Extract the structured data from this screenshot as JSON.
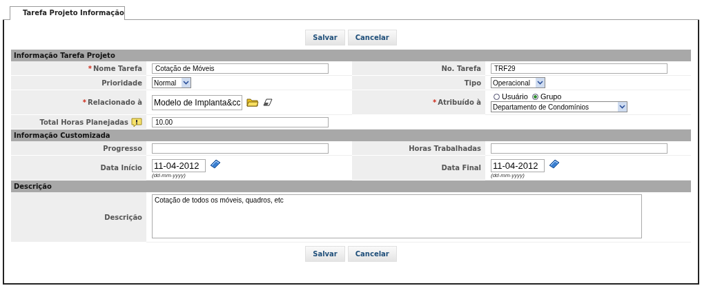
{
  "tab": {
    "label": "Tarefa Projeto Informação",
    "selected": true
  },
  "buttons_top": [
    "Salvar",
    "Cancelar"
  ],
  "sections": [
    {
      "title": "Informação Tarefa Projeto",
      "rows": [
        [
          {
            "label": "Nome Tarefa",
            "mark": "*",
            "kind": "text",
            "value": "Cotação de Móveis"
          },
          {
            "label": "No. Tarefa",
            "kind": "text",
            "value": "TRF29"
          }
        ],
        [
          {
            "label": "Prioridade",
            "kind": "select",
            "value": "Normal"
          },
          {
            "label": "Tipo",
            "kind": "select",
            "value": "Operacional"
          }
        ],
        [
          {
            "label": "Relacionado à",
            "mark": "*",
            "kind": "lookup",
            "value": "Modelo de Implanta&cc"
          },
          {
            "label": "Atribuído à",
            "mark": "*",
            "kind": "assign",
            "options": [
              {
                "label": "Usuário",
                "selected": false
              },
              {
                "label": "Grupo",
                "selected": true
              }
            ],
            "value": "Departamento de Condomínios"
          }
        ],
        [
          {
            "label": "Total Horas Planejadas",
            "help": true,
            "kind": "text",
            "value": "10.00"
          }
        ]
      ]
    },
    {
      "title": "Informação Customizada",
      "rows": [
        [
          {
            "label": "Progresso",
            "kind": "text"
          },
          {
            "label": "Horas Trabalhadas",
            "kind": "text"
          }
        ],
        [
          {
            "label": "Data Início",
            "kind": "date",
            "value": "11-04-2012",
            "hint": "(dd-mm-yyyy)"
          },
          {
            "label": "Data Final",
            "kind": "date",
            "value": "11-04-2012",
            "hint": "(dd-mm-yyyy)"
          }
        ]
      ]
    },
    {
      "title": "Descrição",
      "rows": [
        [
          {
            "label": "Descrição",
            "kind": "textarea",
            "value": "Cotação de todos os móveis, quadros, etc"
          }
        ]
      ]
    }
  ],
  "buttons_bottom": [
    "Salvar",
    "Cancelar"
  ]
}
